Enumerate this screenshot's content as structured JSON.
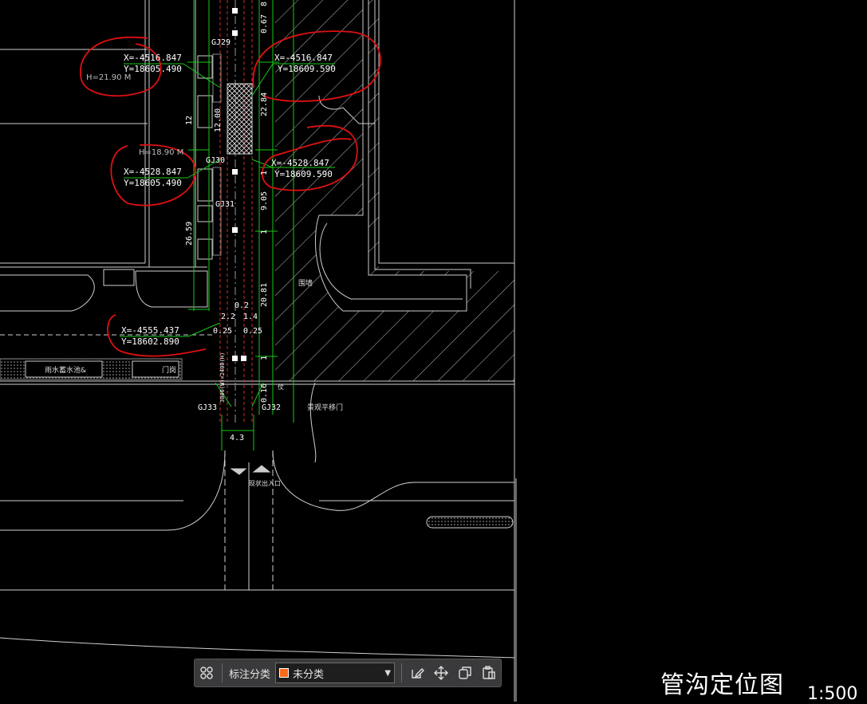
{
  "colors": {
    "background": "#000000",
    "green": "#19c819",
    "red": "#e01010",
    "white": "#ffffff",
    "accent": "#ff6a1a"
  },
  "drawing": {
    "pipes": [
      "GJ29",
      "GJ30",
      "GJ31",
      "GJ32",
      "GJ33"
    ],
    "coords": [
      {
        "x": "X=-4516.847",
        "y": "Y=18605.490"
      },
      {
        "x": "X=-4516.847",
        "y": "Y=18609.590"
      },
      {
        "x": "X=-4528.847",
        "y": "Y=18605.490"
      },
      {
        "x": "X=-4528.847",
        "y": "Y=18609.590"
      },
      {
        "x": "X=-4555.437",
        "y": "Y=18602.890"
      }
    ],
    "elevations": [
      "H=21.90 M",
      "H=18.90 M"
    ],
    "dims": {
      "d12": "12",
      "d2659": "26.59",
      "d1200": "12.00",
      "d2284": "22.84",
      "d1": "1",
      "d905": "9.05",
      "d2081": "20.81",
      "d067": "0.67",
      "d8": "8",
      "d02": "0.2",
      "d22": "2.2",
      "d14": "1.4",
      "d025a": "0.25",
      "d025b": "0.25",
      "d016": "0.16",
      "d43": "4.3",
      "d1b": "1",
      "d1c": "1"
    },
    "labels": {
      "rainpool": "雨水蓄水池&",
      "door": "门岗",
      "wall": "围墙",
      "trench": "3000(W)×2400(H)",
      "gate": "景观平移门",
      "entrance": "现状出入口",
      "tail": "仗"
    }
  },
  "toolbar": {
    "category_label": "标注分类",
    "selected": "未分类",
    "swatch_color": "#ff6a1a"
  },
  "title": "管沟定位图",
  "scale": "1:500"
}
